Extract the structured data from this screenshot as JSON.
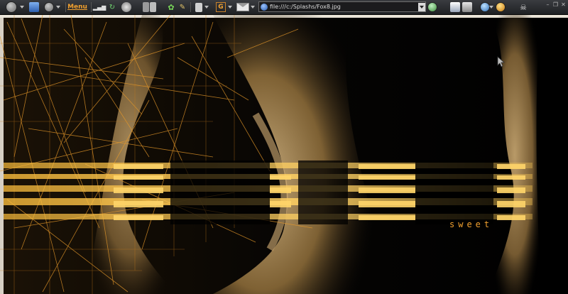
{
  "toolbar": {
    "menu_label": "Menu",
    "address": {
      "value": "file:///c:/Splashs/Fox8.jpg"
    }
  },
  "icons": {
    "back": "back-arrow-icon",
    "forward": "forward-arrow-icon",
    "go": "go-icon"
  },
  "content": {
    "caption": "sweet"
  },
  "colors": {
    "accent": "#f0a030",
    "background": "#000000",
    "skin": "#c89a5a"
  }
}
